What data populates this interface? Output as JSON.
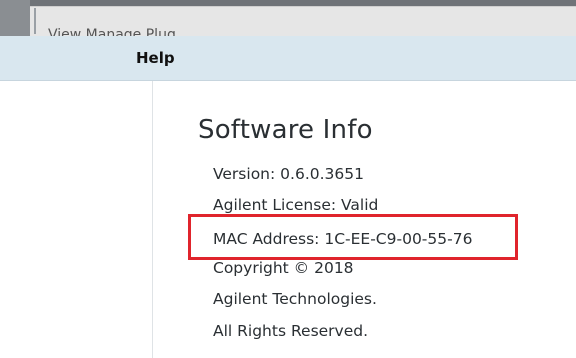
{
  "window": {
    "top_strip_text": "View    Manage    Plug..."
  },
  "menu": {
    "help_label": "Help"
  },
  "software_info": {
    "title": "Software Info",
    "version_label": "Version:",
    "version_value": "0.6.0.3651",
    "license_label": "Agilent License:",
    "license_value": "Valid",
    "mac_label": "MAC Address:",
    "mac_value": "1C-EE-C9-00-55-76",
    "copyright": "Copyright © 2018",
    "company": "Agilent Technologies.",
    "rights": "All Rights Reserved."
  },
  "annotations": {
    "highlight_color": "#e0242c"
  }
}
